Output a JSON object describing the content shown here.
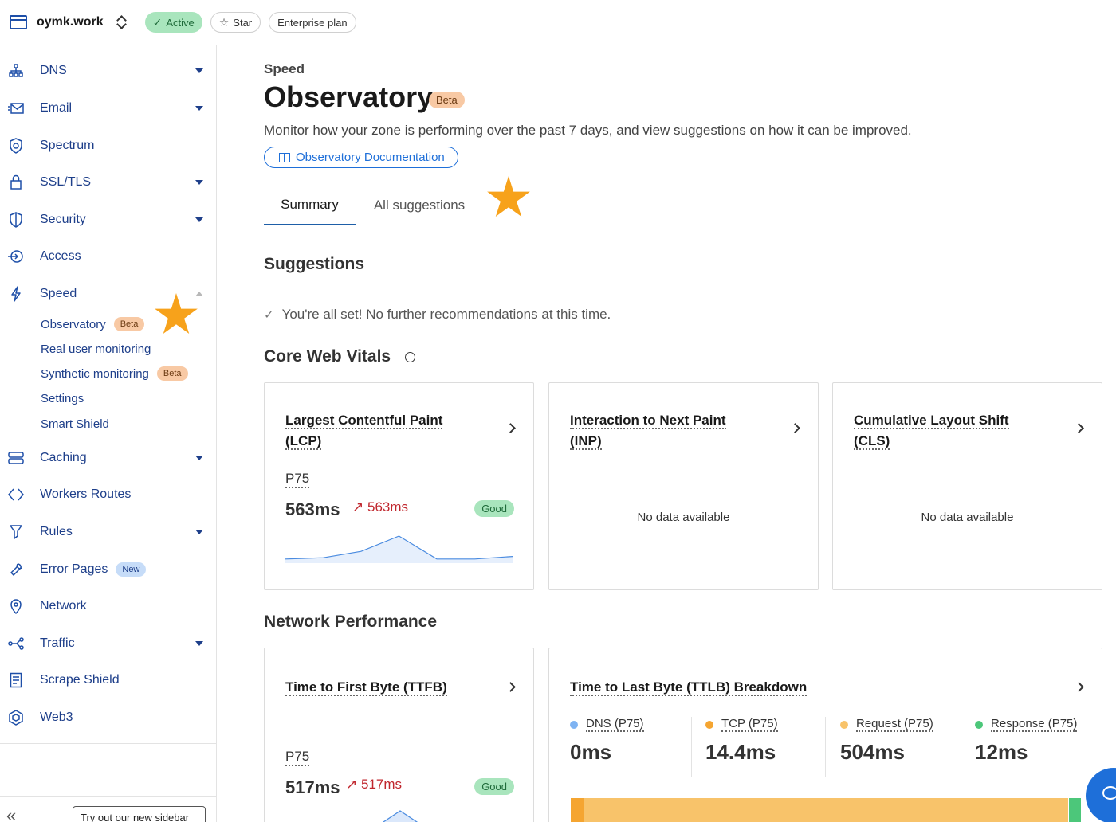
{
  "topbar": {
    "zone_name": "oymk.work",
    "status": "Active",
    "star_label": "Star",
    "plan": "Enterprise plan"
  },
  "sidebar": {
    "items": [
      {
        "label": "DNS",
        "icon": "sitemap-icon",
        "expandable": true
      },
      {
        "label": "Email",
        "icon": "email-icon",
        "expandable": true
      },
      {
        "label": "Spectrum",
        "icon": "spectrum-shield-icon",
        "expandable": false
      },
      {
        "label": "SSL/TLS",
        "icon": "lock-icon",
        "expandable": true
      },
      {
        "label": "Security",
        "icon": "shield-icon",
        "expandable": true
      },
      {
        "label": "Access",
        "icon": "access-icon",
        "expandable": false
      },
      {
        "label": "Speed",
        "icon": "lightning-icon",
        "expandable": true,
        "expanded": true
      },
      {
        "label": "Caching",
        "icon": "server-icon",
        "expandable": true
      },
      {
        "label": "Workers Routes",
        "icon": "code-icon",
        "expandable": false
      },
      {
        "label": "Rules",
        "icon": "filter-icon",
        "expandable": true
      },
      {
        "label": "Error Pages",
        "icon": "wrench-icon",
        "expandable": false,
        "badge": "New"
      },
      {
        "label": "Network",
        "icon": "location-pin-icon",
        "expandable": false
      },
      {
        "label": "Traffic",
        "icon": "traffic-icon",
        "expandable": true
      },
      {
        "label": "Scrape Shield",
        "icon": "document-icon",
        "expandable": false
      },
      {
        "label": "Web3",
        "icon": "web3-icon",
        "expandable": false
      }
    ],
    "speed_sub": [
      {
        "label": "Observatory",
        "badge": "Beta"
      },
      {
        "label": "Real user monitoring",
        "badge": ""
      },
      {
        "label": "Synthetic monitoring",
        "badge": "Beta"
      },
      {
        "label": "Settings",
        "badge": ""
      },
      {
        "label": "Smart Shield",
        "badge": ""
      }
    ],
    "new_sidebar_button": "Try out our new sidebar"
  },
  "main": {
    "breadcrumb": "Speed",
    "title": "Observatory",
    "title_badge": "Beta",
    "subtitle": "Monitor how your zone is performing over the past 7 days, and view suggestions on how it can be improved.",
    "doc_button": "Observatory Documentation",
    "tabs": [
      {
        "label": "Summary",
        "active": true
      },
      {
        "label": "All suggestions",
        "active": false
      }
    ],
    "suggestions": {
      "title": "Suggestions",
      "message": "You're all set! No further recommendations at this time."
    },
    "core_web_vitals": {
      "title": "Core Web Vitals",
      "cards": [
        {
          "title_line1": "Largest Contentful Paint",
          "title_line2": "(LCP)",
          "p75_label": "P75",
          "value": "563ms",
          "delta": "563ms",
          "status": "Good",
          "sparkline": [
            0.1,
            0.15,
            0.4,
            1.0,
            0.1,
            0.1,
            0.2
          ]
        },
        {
          "title_line1": "Interaction to Next Paint",
          "title_line2": "(INP)",
          "no_data": "No data available"
        },
        {
          "title_line1": "Cumulative Layout Shift",
          "title_line2": "(CLS)",
          "no_data": "No data available"
        }
      ]
    },
    "network_performance": {
      "title": "Network Performance",
      "ttfb": {
        "title": "Time to First Byte (TTFB)",
        "p75_label": "P75",
        "value": "517ms",
        "delta": "517ms",
        "status": "Good"
      },
      "ttlb": {
        "title": "Time to Last Byte (TTLB) Breakdown",
        "metrics": [
          {
            "label": "DNS (P75)",
            "value": "0ms",
            "color": "#7eb3f2"
          },
          {
            "label": "TCP (P75)",
            "value": "14.4ms",
            "color": "#f5a531"
          },
          {
            "label": "Request (P75)",
            "value": "504ms",
            "color": "#f8c36a"
          },
          {
            "label": "Response (P75)",
            "value": "12ms",
            "color": "#4cc77a"
          }
        ]
      }
    }
  }
}
